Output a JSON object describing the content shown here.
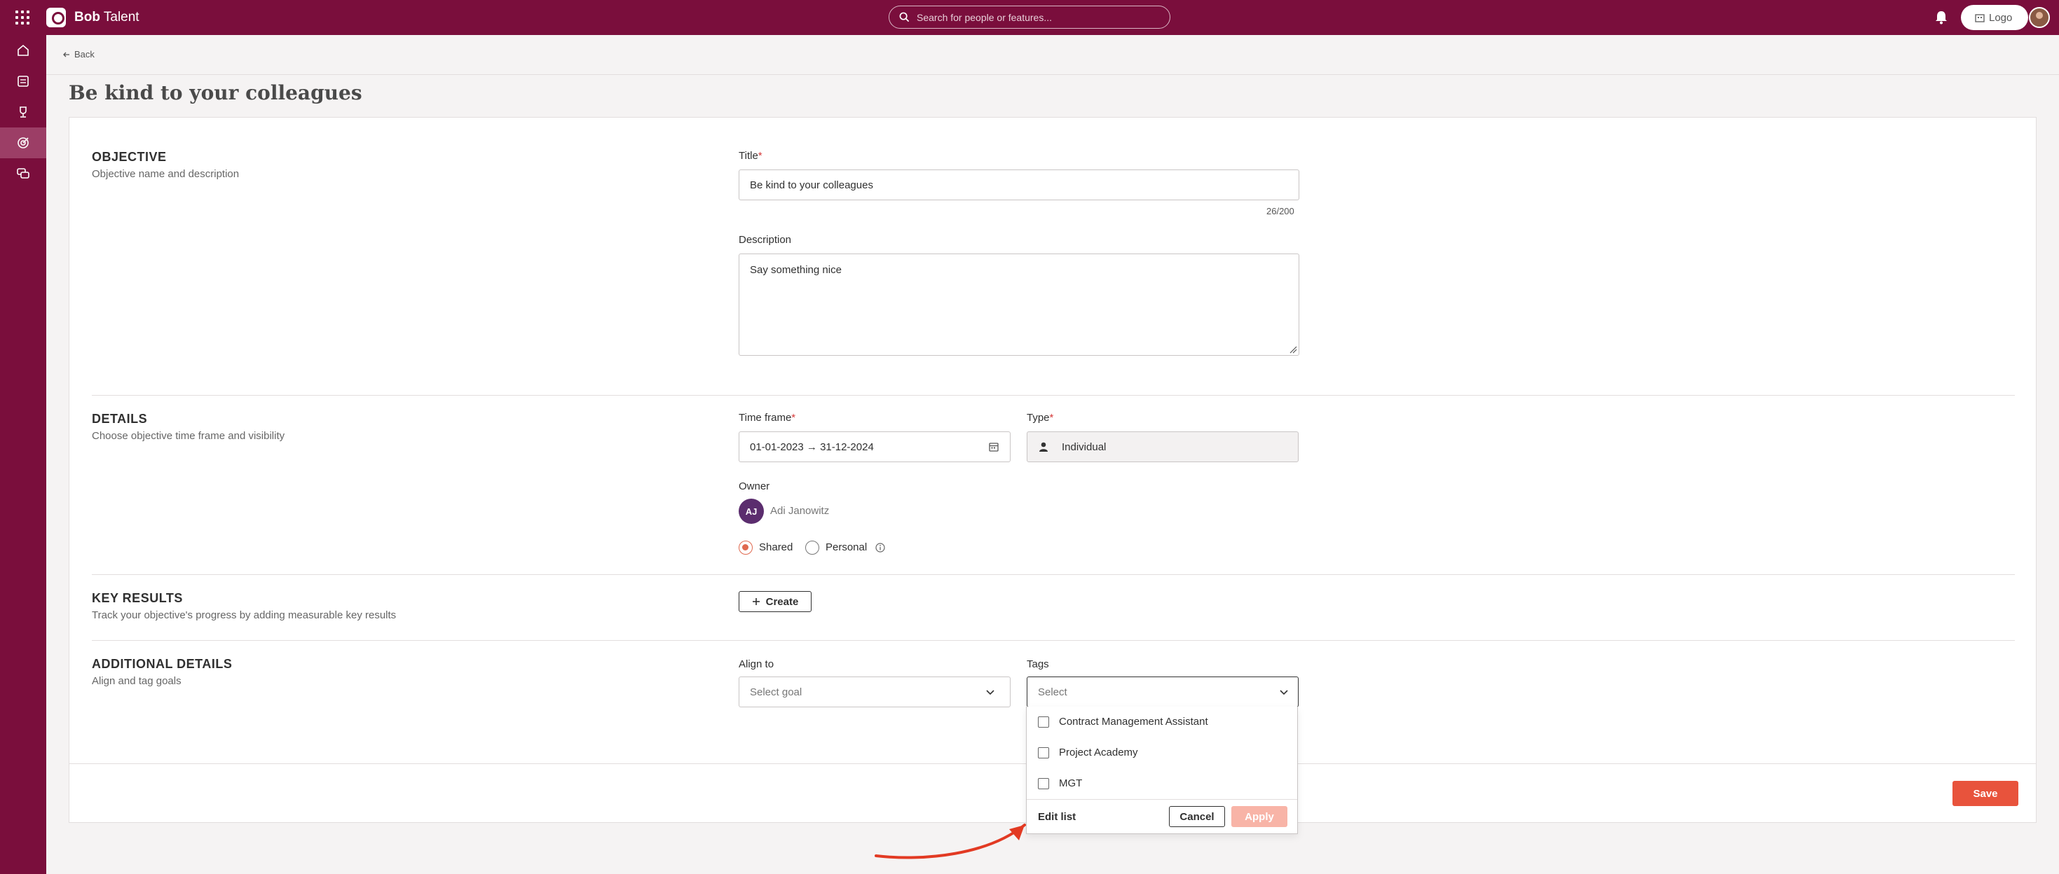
{
  "app": {
    "brand_bold": "Bob",
    "brand_rest": " Talent",
    "search_placeholder": "Search for people or features...",
    "logo_button": "Logo"
  },
  "sidebar": {
    "items": [
      {
        "icon": "home-icon"
      },
      {
        "icon": "list-icon"
      },
      {
        "icon": "trophy-icon"
      },
      {
        "icon": "goals-icon",
        "active": true
      },
      {
        "icon": "chat-icon"
      }
    ]
  },
  "page": {
    "back_label": "Back",
    "title": "Be kind to your colleagues"
  },
  "objective": {
    "heading": "OBJECTIVE",
    "sub": "Objective name and description",
    "title_label": "Title",
    "title_value": "Be kind to your colleagues",
    "counter": "26/200",
    "description_label": "Description",
    "description_value": "Say something nice"
  },
  "details": {
    "heading": "DETAILS",
    "sub": "Choose objective time frame and visibility",
    "timeframe_label": "Time frame",
    "timeframe_value": "01-01-2023 → 31-12-2024",
    "type_label": "Type",
    "type_value": "Individual",
    "owner_label": "Owner",
    "owner_initials": "AJ",
    "owner_name": "Adi Janowitz",
    "radio_shared": "Shared",
    "radio_personal": "Personal",
    "selected_visibility": "Shared"
  },
  "key_results": {
    "heading": "KEY RESULTS",
    "sub": "Track your objective's progress by adding measurable key results",
    "create_label": "Create"
  },
  "additional": {
    "heading": "ADDITIONAL DETAILS",
    "sub": "Align and tag goals",
    "align_label": "Align to",
    "align_placeholder": "Select goal",
    "tags_label": "Tags",
    "tags_placeholder": "Select",
    "tag_options": [
      "Contract Management Assistant",
      "Project Academy",
      "MGT"
    ],
    "edit_list": "Edit list",
    "cancel": "Cancel",
    "apply": "Apply"
  },
  "footer": {
    "save": "Save"
  },
  "colors": {
    "brand": "#7a0e3c",
    "accent": "#e8533c",
    "apply_disabled": "#f8b4a7",
    "owner_avatar": "#5b2d6e"
  }
}
